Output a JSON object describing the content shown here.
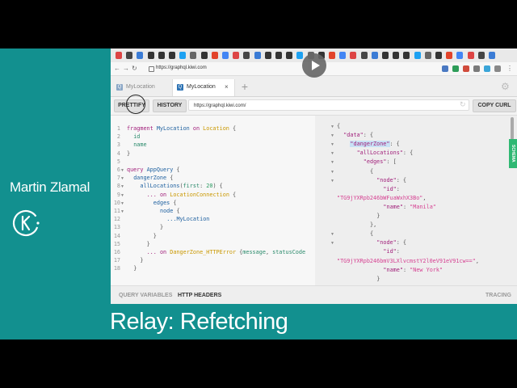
{
  "video": {
    "speaker": "Martin Zlamal",
    "title": "Relay: Refetching",
    "colors": {
      "teal": "#12908f",
      "black": "#000000"
    }
  },
  "browser": {
    "url": "https://graphql.kiwi.com",
    "extension_icons": [
      "gmail-icon",
      "github-icon",
      "translate-icon",
      "github-icon",
      "github-icon",
      "github-icon",
      "twitter-icon",
      "wikipedia-icon",
      "github-icon",
      "gitlab-icon",
      "chrome-icon"
    ]
  },
  "graphiql": {
    "tabs": [
      {
        "label": "MyLocation",
        "active": false
      },
      {
        "label": "MyLocation",
        "active": true
      }
    ],
    "tab_badge": "Q",
    "buttons": {
      "prettify": "PRETTIFY",
      "history": "HISTORY",
      "copy_curl": "COPY CURL"
    },
    "endpoint": "https://graphql.kiwi.com/",
    "schema_tab": "SCHEMA",
    "footer": {
      "query_variables": "QUERY VARIABLES",
      "http_headers": "HTTP HEADERS",
      "tracing": "TRACING"
    },
    "query_lines": [
      {
        "num": "1",
        "fold": false,
        "indent": 0,
        "tokens": [
          {
            "t": "fragment ",
            "c": "k"
          },
          {
            "t": "MyLocation",
            "c": "d"
          },
          {
            "t": " on ",
            "c": "k"
          },
          {
            "t": "Location",
            "c": "t"
          },
          {
            "t": " {",
            "c": "p"
          }
        ]
      },
      {
        "num": "2",
        "fold": false,
        "indent": 1,
        "tokens": [
          {
            "t": "id",
            "c": "n"
          }
        ]
      },
      {
        "num": "3",
        "fold": false,
        "indent": 1,
        "tokens": [
          {
            "t": "name",
            "c": "n"
          }
        ]
      },
      {
        "num": "4",
        "fold": false,
        "indent": 0,
        "tokens": [
          {
            "t": "}",
            "c": "p"
          }
        ]
      },
      {
        "num": "5",
        "fold": false,
        "indent": 0,
        "tokens": []
      },
      {
        "num": "6",
        "fold": true,
        "indent": 0,
        "tokens": [
          {
            "t": "query ",
            "c": "k"
          },
          {
            "t": "AppQuery",
            "c": "d"
          },
          {
            "t": " {",
            "c": "p"
          }
        ]
      },
      {
        "num": "7",
        "fold": true,
        "indent": 1,
        "tokens": [
          {
            "t": "dangerZone",
            "c": "f"
          },
          {
            "t": " {",
            "c": "p"
          }
        ]
      },
      {
        "num": "8",
        "fold": true,
        "indent": 2,
        "tokens": [
          {
            "t": "allLocations",
            "c": "f"
          },
          {
            "t": "(",
            "c": "p"
          },
          {
            "t": "first",
            "c": "n"
          },
          {
            "t": ": ",
            "c": "p"
          },
          {
            "t": "20",
            "c": "num"
          },
          {
            "t": ") {",
            "c": "p"
          }
        ]
      },
      {
        "num": "9",
        "fold": true,
        "indent": 3,
        "tokens": [
          {
            "t": "... on ",
            "c": "k"
          },
          {
            "t": "LocationConnection",
            "c": "t"
          },
          {
            "t": " {",
            "c": "p"
          }
        ]
      },
      {
        "num": "10",
        "fold": true,
        "indent": 4,
        "tokens": [
          {
            "t": "edges",
            "c": "f"
          },
          {
            "t": " {",
            "c": "p"
          }
        ]
      },
      {
        "num": "11",
        "fold": true,
        "indent": 5,
        "tokens": [
          {
            "t": "node",
            "c": "f"
          },
          {
            "t": " {",
            "c": "p"
          }
        ]
      },
      {
        "num": "12",
        "fold": false,
        "indent": 6,
        "tokens": [
          {
            "t": "...MyLocation",
            "c": "d"
          }
        ]
      },
      {
        "num": "13",
        "fold": false,
        "indent": 5,
        "tokens": [
          {
            "t": "}",
            "c": "p"
          }
        ]
      },
      {
        "num": "14",
        "fold": false,
        "indent": 4,
        "tokens": [
          {
            "t": "}",
            "c": "p"
          }
        ]
      },
      {
        "num": "15",
        "fold": false,
        "indent": 3,
        "tokens": [
          {
            "t": "}",
            "c": "p"
          }
        ]
      },
      {
        "num": "16",
        "fold": false,
        "indent": 3,
        "tokens": [
          {
            "t": "... on ",
            "c": "k"
          },
          {
            "t": "DangerZone_HTTPError",
            "c": "t"
          },
          {
            "t": " {",
            "c": "p"
          },
          {
            "t": "message",
            "c": "n"
          },
          {
            "t": ", ",
            "c": "p"
          },
          {
            "t": "statusCode",
            "c": "n"
          }
        ]
      },
      {
        "num": "17",
        "fold": false,
        "indent": 2,
        "tokens": [
          {
            "t": "}",
            "c": "p"
          }
        ]
      },
      {
        "num": "18",
        "fold": false,
        "indent": 1,
        "tokens": [
          {
            "t": "}",
            "c": "p"
          }
        ]
      }
    ],
    "result_lines": [
      {
        "fold": true,
        "indent": 0,
        "tokens": [
          {
            "t": "{",
            "c": "p"
          }
        ]
      },
      {
        "fold": true,
        "indent": 1,
        "tokens": [
          {
            "t": "\"data\"",
            "c": "jk"
          },
          {
            "t": ": {",
            "c": "p"
          }
        ]
      },
      {
        "fold": true,
        "indent": 2,
        "tokens": [
          {
            "t": "\"dangerZone\"",
            "c": "jks"
          },
          {
            "t": ": {",
            "c": "p"
          }
        ]
      },
      {
        "fold": true,
        "indent": 3,
        "tokens": [
          {
            "t": "\"allLocations\"",
            "c": "jk"
          },
          {
            "t": ": {",
            "c": "p"
          }
        ]
      },
      {
        "fold": true,
        "indent": 4,
        "tokens": [
          {
            "t": "\"edges\"",
            "c": "jk"
          },
          {
            "t": ": [",
            "c": "p"
          }
        ]
      },
      {
        "fold": true,
        "indent": 5,
        "tokens": [
          {
            "t": "{",
            "c": "p"
          }
        ]
      },
      {
        "fold": true,
        "indent": 6,
        "tokens": [
          {
            "t": "\"node\"",
            "c": "jk"
          },
          {
            "t": ": {",
            "c": "p"
          }
        ]
      },
      {
        "fold": false,
        "indent": 7,
        "tokens": [
          {
            "t": "\"id\"",
            "c": "jk"
          },
          {
            "t": ":",
            "c": "p"
          }
        ]
      },
      {
        "fold": false,
        "indent": 0,
        "tokens": [
          {
            "t": "\"TG9jYXRpb246bWFuaWxhX3Bo\"",
            "c": "s"
          },
          {
            "t": ",",
            "c": "p"
          }
        ]
      },
      {
        "fold": false,
        "indent": 7,
        "tokens": [
          {
            "t": "\"name\"",
            "c": "jk"
          },
          {
            "t": ": ",
            "c": "p"
          },
          {
            "t": "\"Manila\"",
            "c": "s"
          }
        ]
      },
      {
        "fold": false,
        "indent": 6,
        "tokens": [
          {
            "t": "}",
            "c": "p"
          }
        ]
      },
      {
        "fold": false,
        "indent": 5,
        "tokens": [
          {
            "t": "},",
            "c": "p"
          }
        ]
      },
      {
        "fold": true,
        "indent": 5,
        "tokens": [
          {
            "t": "{",
            "c": "p"
          }
        ]
      },
      {
        "fold": true,
        "indent": 6,
        "tokens": [
          {
            "t": "\"node\"",
            "c": "jk"
          },
          {
            "t": ": {",
            "c": "p"
          }
        ]
      },
      {
        "fold": false,
        "indent": 7,
        "tokens": [
          {
            "t": "\"id\"",
            "c": "jk"
          },
          {
            "t": ":",
            "c": "p"
          }
        ]
      },
      {
        "fold": false,
        "indent": 0,
        "tokens": [
          {
            "t": "\"TG9jYXRpb246bmV3LXlvcmstY2l0eV91eV91cw==\"",
            "c": "s"
          },
          {
            "t": ",",
            "c": "p"
          }
        ]
      },
      {
        "fold": false,
        "indent": 7,
        "tokens": [
          {
            "t": "\"name\"",
            "c": "jk"
          },
          {
            "t": ": ",
            "c": "p"
          },
          {
            "t": "\"New York\"",
            "c": "s"
          }
        ]
      },
      {
        "fold": false,
        "indent": 6,
        "tokens": [
          {
            "t": "}",
            "c": "p"
          }
        ]
      }
    ]
  }
}
